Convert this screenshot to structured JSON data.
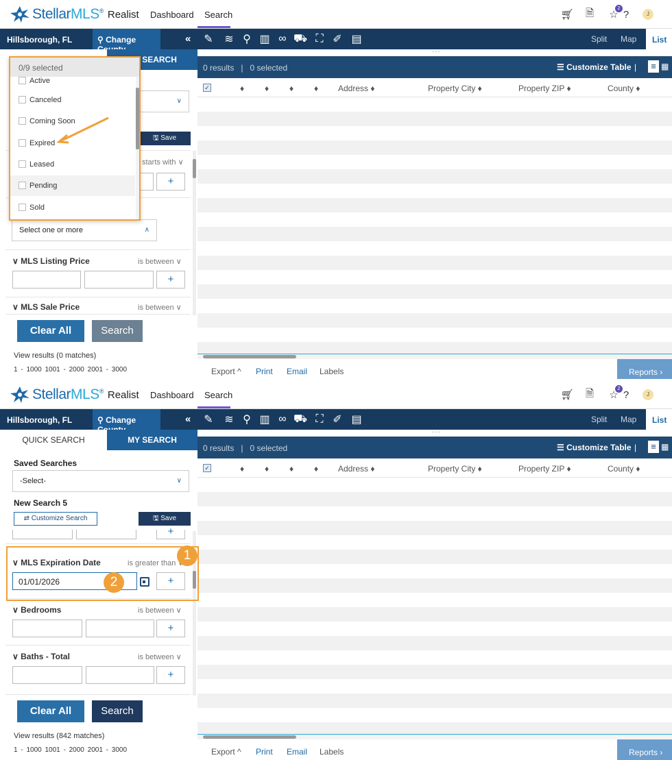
{
  "app": {
    "brand_a": "Stellar",
    "brand_b": "MLS",
    "reg": "®",
    "product": "Realist"
  },
  "nav": {
    "dashboard": "Dashboard",
    "search": "Search"
  },
  "top_icons": {
    "cart": "cart-icon",
    "document": "document-icon",
    "star": "star-icon",
    "star_badge": "2",
    "help": "help-icon",
    "avatar": "J"
  },
  "county": {
    "name": "Hillsborough, FL",
    "change": "Change County",
    "collapse": "«"
  },
  "map_tools": [
    "draw-icon",
    "layers-icon",
    "pin-icon",
    "chart-icon",
    "binoculars-icon",
    "car-icon",
    "map-person-icon",
    "ruler-icon",
    "comment-icon"
  ],
  "views": {
    "split": "Split",
    "map": "Map",
    "list": "List"
  },
  "tabs": {
    "quick": "QUICK SEARCH",
    "my": "MY SEARCH"
  },
  "results": {
    "count": "0 results",
    "sep": "|",
    "selected": "0 selected",
    "customize": "Customize Table",
    "views_sep": "|"
  },
  "columns": {
    "sort": "♦",
    "address": "Address ♦",
    "city": "Property City ♦",
    "zip": "Property ZIP ♦",
    "county": "County ♦"
  },
  "footer": {
    "export": "Export ^",
    "print": "Print",
    "email": "Email",
    "labels": "Labels",
    "reports": "Reports ›"
  },
  "colors": {
    "navy": "#173a5e",
    "blue": "#1f5f9a",
    "accent": "#f0a038",
    "results_bar": "#1f4a73"
  },
  "panel1": {
    "dropdown": {
      "header": "0/9 selected",
      "items": [
        "Active",
        "Canceled",
        "Coming Soon",
        "Expired",
        "Leased",
        "Pending",
        "Sold"
      ]
    },
    "save": "Save",
    "starts_with": "starts with ∨",
    "multi_placeholder": "Select one or more",
    "listing_price": {
      "label": "MLS Listing Price",
      "op": "is between ∨"
    },
    "sale_price": {
      "label": "MLS Sale Price",
      "op": "is between ∨"
    },
    "clear": "Clear All",
    "search": "Search",
    "view_results": "View results  (0 matches)",
    "pages": "1 - 1000   1001 - 2000   2001 - 3000"
  },
  "panel2": {
    "saved_searches": "Saved Searches",
    "select": "-Select-",
    "new_search": "New Search 5",
    "customize": "⇄  Customize Search",
    "save": "Save",
    "expiration": {
      "label": "MLS Expiration Date",
      "op": "is greater than ∨",
      "value": "01/01/2026"
    },
    "bedrooms": {
      "label": "Bedrooms",
      "op": "is between ∨"
    },
    "baths": {
      "label": "Baths - Total",
      "op": "is between ∨"
    },
    "callouts": [
      "1",
      "2"
    ],
    "clear": "Clear All",
    "search": "Search",
    "view_results": "View results  (842 matches)",
    "pages": "1 - 1000   1001 - 2000   2001 - 3000"
  }
}
